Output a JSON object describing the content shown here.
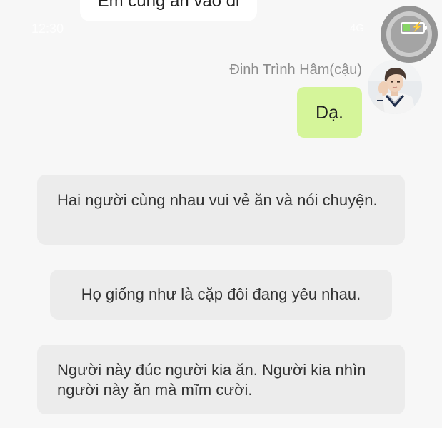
{
  "status_bar": {
    "time": "12:30",
    "signal": "4G"
  },
  "chat": {
    "previous_message": "Em cũng ăn vào đi",
    "outgoing": {
      "sender_name": "Đinh Trình Hâm(cậu)",
      "text": "Dạ."
    },
    "narrations": [
      "Hai người cùng nhau vui vẻ ăn và nói chuyện.",
      "Họ giống như là cặp đôi đang yêu nhau.",
      "Người này đúc người kia ăn. Người kia nhìn người này ăn mà mĩm cười."
    ]
  },
  "floating_button": {
    "icon": "battery-charging-icon",
    "battery_level": 0.35,
    "battery_color": "#7ed35a"
  },
  "colors": {
    "background": "#f7f7f7",
    "outgoing_bubble": "#d5f59a",
    "narration_bg": "#ececec",
    "name_text": "#8c8c8c"
  }
}
